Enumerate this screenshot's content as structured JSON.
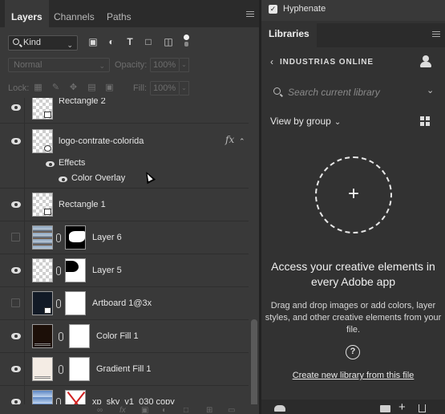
{
  "layers_panel": {
    "tabs": [
      {
        "label": "Layers",
        "active": true
      },
      {
        "label": "Channels",
        "active": false
      },
      {
        "label": "Paths",
        "active": false
      }
    ],
    "filter": {
      "kind_label": "Kind"
    },
    "blend_mode": "Normal",
    "opacity_label": "Opacity:",
    "opacity_value": "100%",
    "lock_label": "Lock:",
    "fill_label": "Fill:",
    "fill_value": "100%",
    "layers": [
      {
        "name": "Rectangle 2",
        "visible": true,
        "kind": "shape"
      },
      {
        "name": "logo-contrate-colorida",
        "visible": true,
        "kind": "smart",
        "fx": "fx",
        "effects_label": "Effects",
        "effects": [
          "Color Overlay"
        ]
      },
      {
        "name": "Rectangle 1",
        "visible": true,
        "kind": "shape"
      },
      {
        "name": "Layer 6",
        "visible": false,
        "kind": "masked"
      },
      {
        "name": "Layer 5",
        "visible": true,
        "kind": "masked"
      },
      {
        "name": "Artboard 1@3x",
        "visible": false,
        "kind": "masked"
      },
      {
        "name": "Color Fill 1",
        "visible": true,
        "kind": "fill"
      },
      {
        "name": "Gradient Fill 1",
        "visible": true,
        "kind": "fill"
      },
      {
        "name": "xp_sky_v1_030 copy",
        "visible": true,
        "kind": "masked"
      }
    ]
  },
  "right_panel": {
    "hyphenate": {
      "label": "Hyphenate",
      "checked": true
    },
    "libraries_tab": "Libraries",
    "library_name": "INDUSTRIAS ONLINE",
    "search_placeholder": "Search current library",
    "view_by": "View by group",
    "headline": "Access your creative elements in every Adobe app",
    "description": "Drag and drop images or add colors, layer styles, and other creative elements from your file.",
    "help_glyph": "?",
    "create_link": "Create new library from this file"
  },
  "icons": {
    "filter": [
      "image-filter-icon",
      "adjustment-filter-icon",
      "type-filter-icon",
      "shape-filter-icon",
      "smart-object-filter-icon"
    ],
    "lock": [
      "lock-transparent-icon",
      "lock-image-icon",
      "lock-position-icon",
      "lock-artboard-icon",
      "lock-all-icon"
    ],
    "bottom_bar": [
      "link-layers-icon",
      "fx-icon",
      "add-mask-icon",
      "adjustment-layer-icon",
      "new-group-icon",
      "new-layer-icon",
      "delete-layer-icon"
    ]
  }
}
